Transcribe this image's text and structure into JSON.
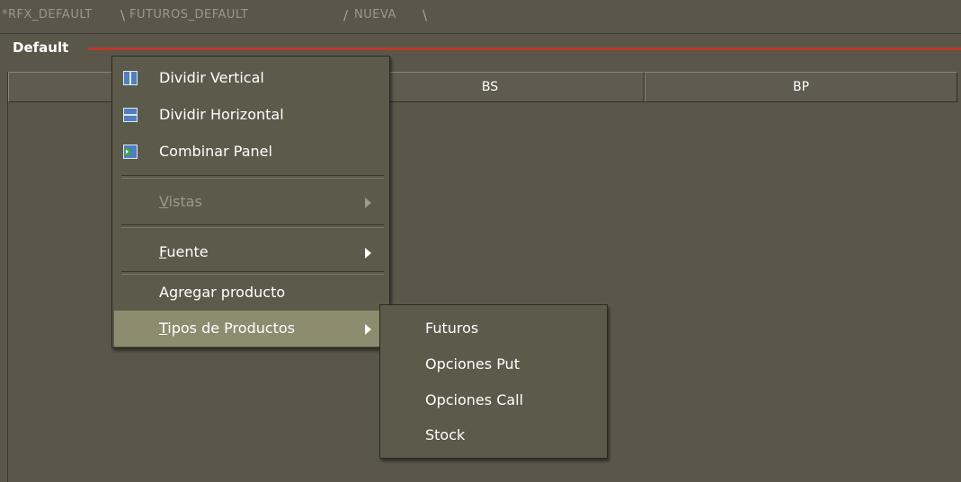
{
  "tabs": [
    {
      "label": "RFX_DEFAULT"
    },
    {
      "label": "FUTUROS_DEFAULT"
    },
    {
      "label": "NUEVA"
    }
  ],
  "panel": {
    "title": "Default"
  },
  "columns": [
    {
      "label": ""
    },
    {
      "label": "BS"
    },
    {
      "label": "BP"
    }
  ],
  "context_menu": {
    "items": [
      {
        "label": "Dividir Vertical",
        "icon": "split-vertical-icon"
      },
      {
        "label": "Dividir Horizontal",
        "icon": "split-horizontal-icon"
      },
      {
        "label": "Combinar Panel",
        "icon": "merge-panel-icon"
      },
      {
        "label": "Vistas",
        "mnemonic": "V",
        "rest": "istas",
        "disabled": true,
        "has_submenu": true
      },
      {
        "label": "Fuente",
        "mnemonic": "F",
        "rest": "uente",
        "has_submenu": true
      },
      {
        "label": "Agregar producto"
      },
      {
        "label": "Tipos de Productos",
        "mnemonic": "T",
        "rest": "ipos de Productos",
        "has_submenu": true,
        "highlighted": true
      }
    ]
  },
  "submenu": {
    "items": [
      {
        "label": "Futuros"
      },
      {
        "label": "Opciones Put"
      },
      {
        "label": "Opciones Call"
      },
      {
        "label": "Stock"
      }
    ]
  },
  "colors": {
    "background": "#5a5649",
    "menu": "#5c5a4a",
    "highlight": "#8e8c6f",
    "accent_line": "#b93a2c",
    "disabled_text": "#9c998b"
  }
}
